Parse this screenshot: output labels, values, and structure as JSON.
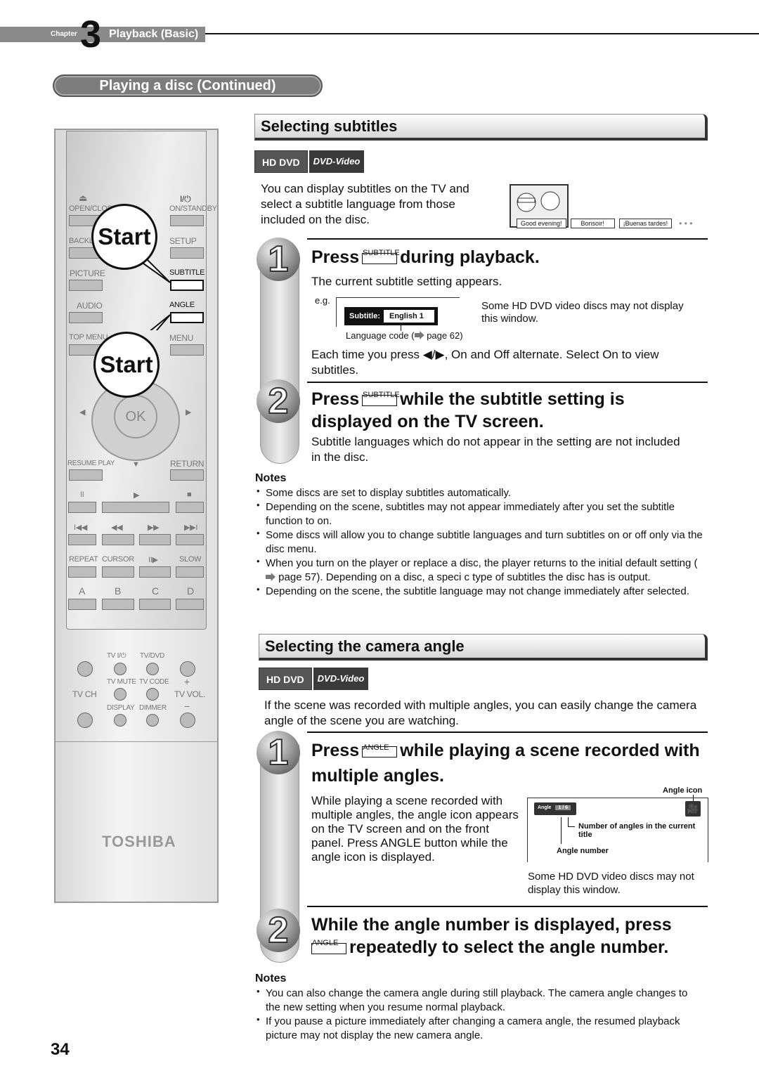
{
  "chapter": {
    "label": "Chapter",
    "number": "3",
    "title": "Playback (Basic)"
  },
  "section_title": "Playing a disc (Continued)",
  "remote": {
    "open_close": "OPEN/CLOSE",
    "on_standby": "ON/STANDBY",
    "power_symbol": "I/⏻",
    "eject_symbol": "⏏",
    "backlight": "BACKLI",
    "setup": "SETUP",
    "picture": "PICTURE",
    "subtitle": "SUBTITLE",
    "audio": "AUDIO",
    "angle": "ANGLE",
    "top_menu": "TOP MENU",
    "menu": "MENU",
    "ok": "OK",
    "resume_play": "RESUME PLAY",
    "return": "RETURN",
    "pause": "II",
    "play": "▶",
    "stop": "■",
    "skip_back": "I◀◀",
    "rewind": "◀◀",
    "ffwd": "▶▶",
    "skip_fwd": "▶▶I",
    "repeat": "REPEAT",
    "cursor": "CURSOR",
    "step": "II▶",
    "slow": "SLOW",
    "a": "A",
    "b": "B",
    "c": "C",
    "d": "D",
    "tv_power": "TV  I/⏻",
    "tv_dvd": "TV/DVD",
    "tv_mute": "TV MUTE",
    "tv_code": "TV CODE",
    "tv_ch": "TV CH",
    "tv_vol": "TV VOL.",
    "plus": "+",
    "minus": "−",
    "display": "DISPLAY",
    "dimmer": "DIMMER",
    "brand": "TOSHIBA",
    "callout_1": "Start",
    "callout_2": "Start"
  },
  "subtitles": {
    "title": "Selecting subtitles",
    "badges": [
      "HD DVD",
      "DVD-Video"
    ],
    "intro": "You can display subtitles on the TV and select a subtitle language from those included on the disc.",
    "illustration": {
      "captions": [
        "Good evening!",
        "Bonsoir!",
        "¡Buenas tardes!"
      ],
      "more": "• • •"
    },
    "step1": {
      "num": "1",
      "press": "Press",
      "key": "SUBTITLE",
      "rest": "during playback.",
      "desc": "The current subtitle setting appears.",
      "eg": "e.g.",
      "osd_label": "Subtitle:",
      "osd_value": "English  1",
      "lang_code_pre": "Language code (",
      "lang_code_post": " page 62)",
      "note": "Some HD DVD video discs may not display this window.",
      "toggle": "Each time you press ◀/▶,  On  and  Off  alternate. Select  On  to view subtitles."
    },
    "step2": {
      "num": "2",
      "press": "Press",
      "key": "SUBTITLE",
      "rest": "while the subtitle setting is",
      "line2": "displayed on the TV screen.",
      "desc": "Subtitle languages which do not appear in the setting are not included in the disc."
    },
    "notes_title": "Notes",
    "notes": [
      "Some discs are set to display subtitles automatically.",
      "Depending on the scene, subtitles may not appear immediately after you set the subtitle function to on.",
      "Some discs will allow you to change subtitle languages and turn subtitles on or off only via the disc menu.",
      "Depending on the scene, the subtitle language may not change immediately after selected."
    ],
    "note4_pre": "When you turn on the player or replace a disc, the player returns to the initial default setting (",
    "note4_post": " page 57). Depending on a disc, a speci  c type of subtitles the disc has is output."
  },
  "angle": {
    "title": "Selecting the camera angle",
    "badges": [
      "HD DVD",
      "DVD-Video"
    ],
    "intro": "If the scene was recorded with multiple angles, you can easily change the camera angle of the scene you are watching.",
    "step1": {
      "num": "1",
      "press": "Press",
      "key": "ANGLE",
      "rest": "while playing a scene recorded with",
      "line2": "multiple angles.",
      "desc": "While playing a scene recorded with multiple angles, the angle icon appears on the TV screen and on the front panel. Press ANGLE button while the angle icon is displayed."
    },
    "diagram": {
      "angle_icon_label": "Angle icon",
      "osd_label": "Angle",
      "osd_value": "1 / 6",
      "num_angles_label": "Number of angles in the current title",
      "angle_number_label": "Angle number",
      "note": "Some HD DVD video discs may not display this window."
    },
    "step2": {
      "num": "2",
      "line1": "While the angle number is displayed, press",
      "key": "ANGLE",
      "rest": "repeatedly to select the angle number."
    },
    "notes_title": "Notes",
    "notes": [
      "You can also change the camera angle during still playback. The camera angle changes to the new setting when you resume normal playback.",
      "If you pause a picture immediately after changing a camera angle, the resumed playback picture may not display the new camera angle."
    ]
  },
  "page_number": "34"
}
